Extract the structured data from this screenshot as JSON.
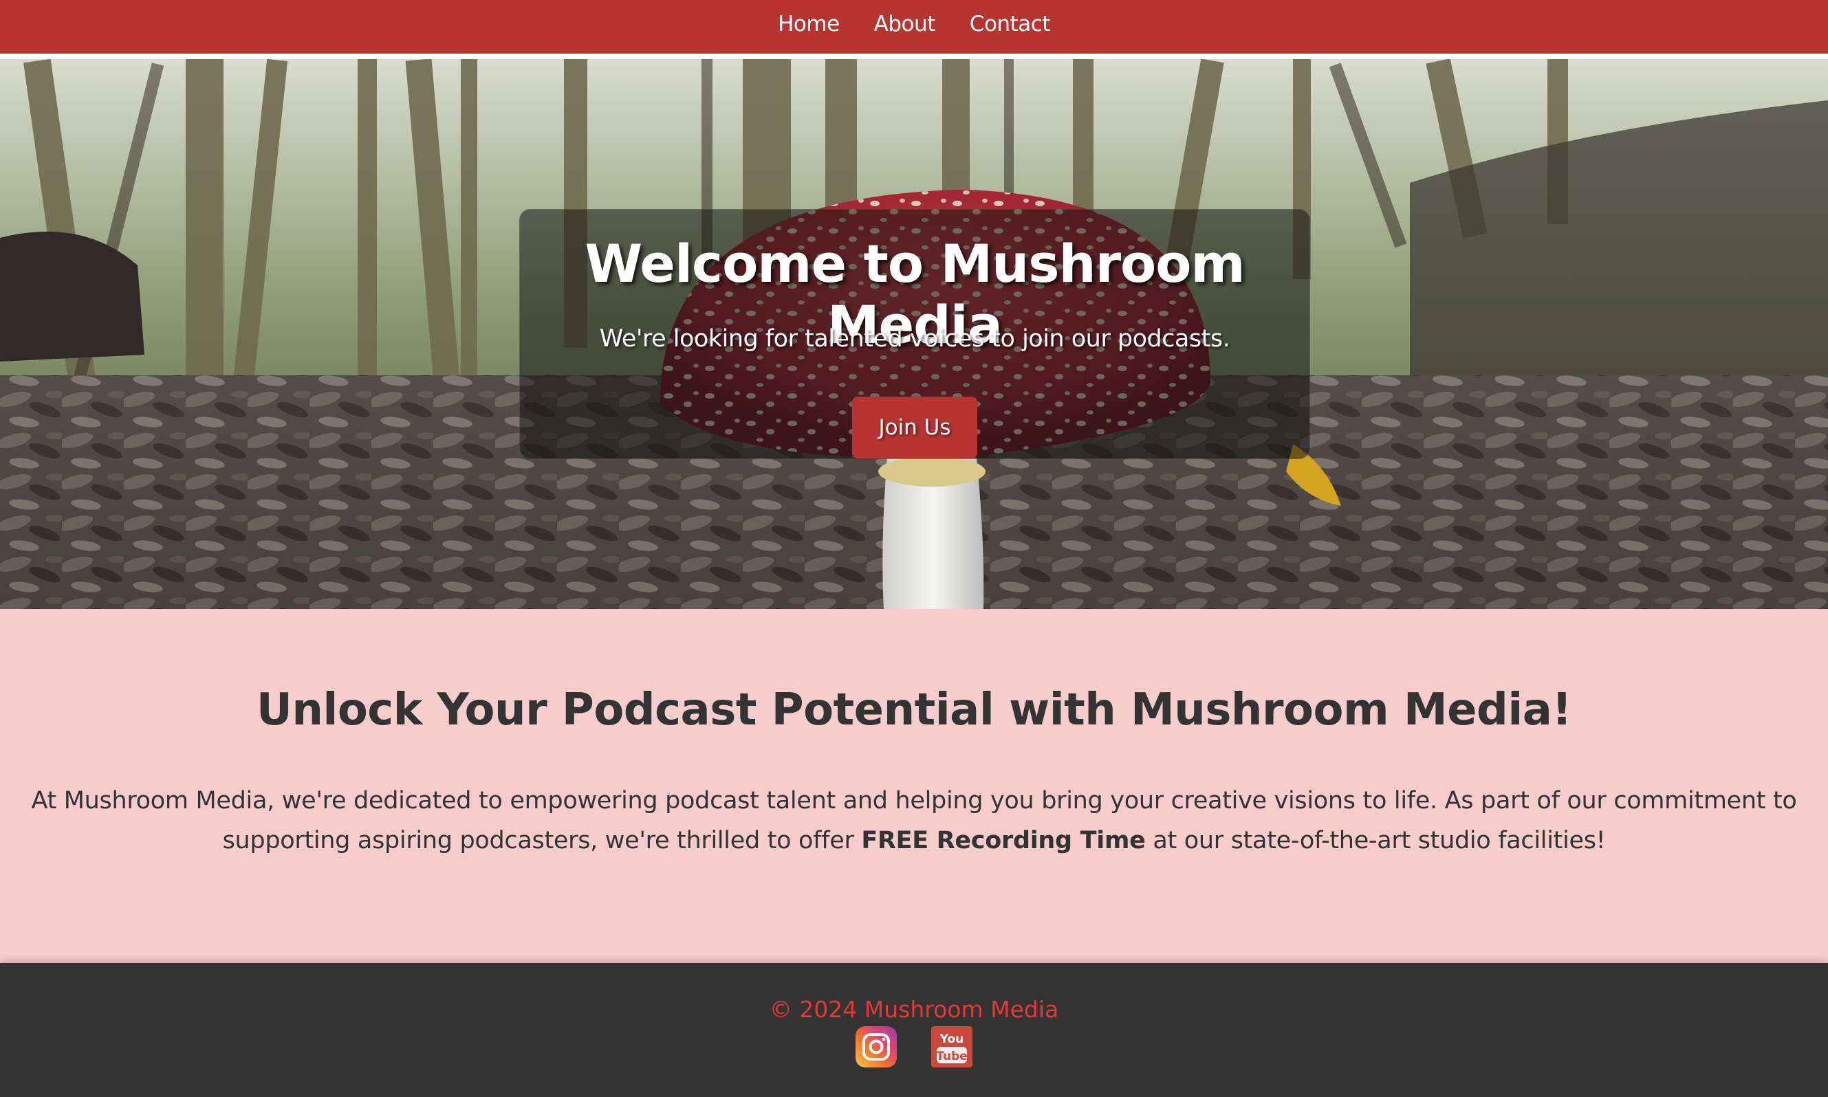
{
  "nav": {
    "items": [
      {
        "label": "Home"
      },
      {
        "label": "About"
      },
      {
        "label": "Contact"
      }
    ]
  },
  "hero": {
    "title": "Welcome to Mushroom Media",
    "subtitle": "We're looking for talented voices to join our podcasts.",
    "cta_label": "Join Us",
    "background": "forest floor with a red fly agaric mushroom"
  },
  "content": {
    "heading": "Unlock Your Podcast Potential with Mushroom Media!",
    "paragraph_before": "At Mushroom Media, we're dedicated to empowering podcast talent and helping you bring your creative visions to life. As part of our commitment to supporting aspiring podcasters, we're thrilled to offer ",
    "paragraph_bold": "FREE Recording Time",
    "paragraph_after": " at our state-of-the-art studio facilities!"
  },
  "footer": {
    "copyright": "© 2024 Mushroom Media",
    "social": [
      {
        "icon": "instagram-icon"
      },
      {
        "icon": "youtube-icon",
        "text_top": "You",
        "text_bottom": "Tube"
      }
    ]
  },
  "colors": {
    "brand_red": "#b83431",
    "page_pink": "#f7cccc",
    "footer_dark": "#333333",
    "copyright_red": "#e53935"
  }
}
